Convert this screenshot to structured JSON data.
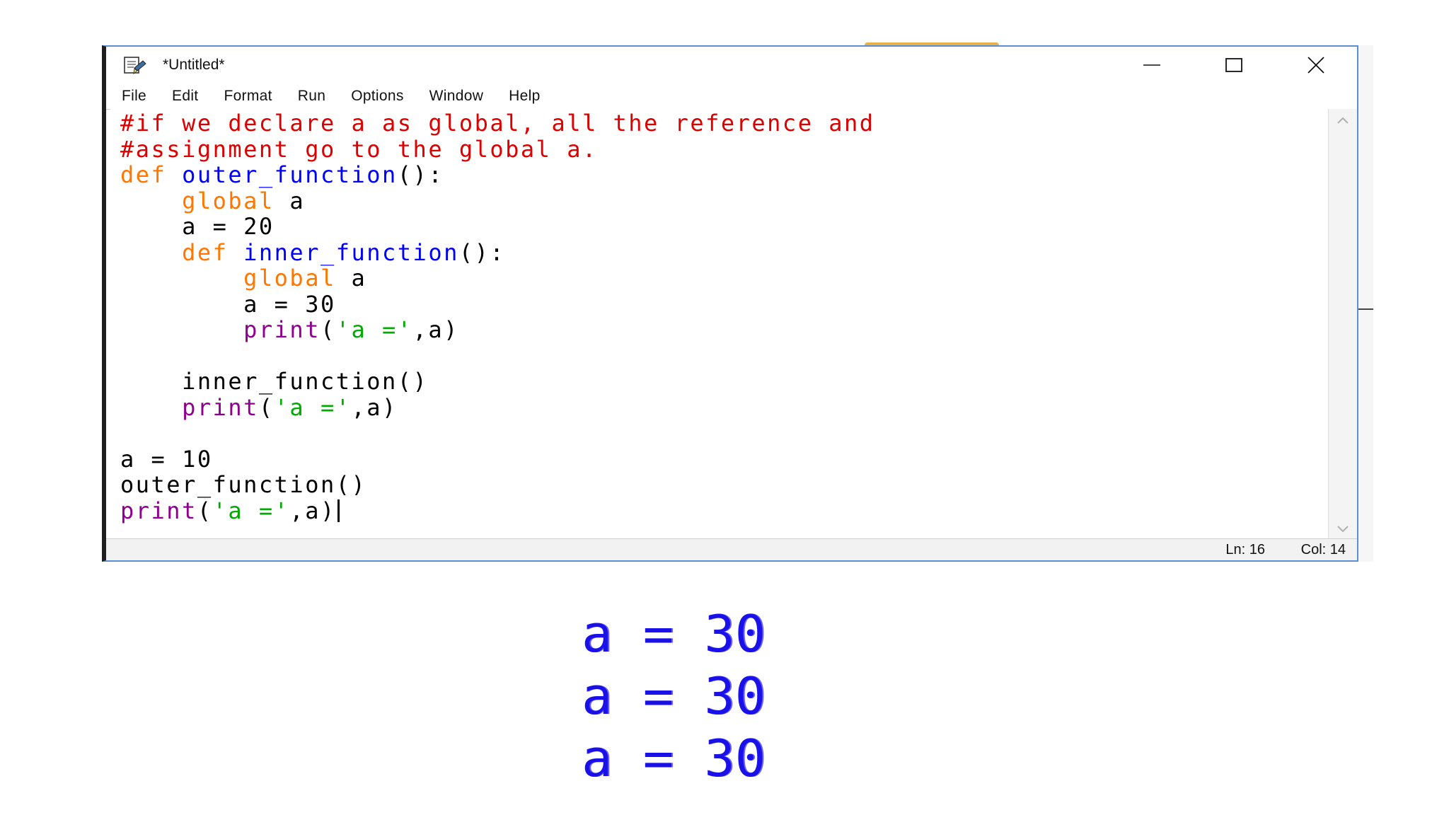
{
  "window": {
    "title": "*Untitled*",
    "icon": "idle-app-icon"
  },
  "window_controls": {
    "minimize_icon": "minimize-icon",
    "maximize_icon": "maximize-icon",
    "close_icon": "close-icon"
  },
  "menubar": {
    "items": [
      "File",
      "Edit",
      "Format",
      "Run",
      "Options",
      "Window",
      "Help"
    ]
  },
  "editor": {
    "lines": [
      [
        {
          "t": "#if we declare a as global, all the reference and",
          "c": "comment"
        }
      ],
      [
        {
          "t": "#assignment go to the global a.",
          "c": "comment"
        }
      ],
      [
        {
          "t": "def",
          "c": "keyword"
        },
        {
          "t": " ",
          "c": "plain"
        },
        {
          "t": "outer_function",
          "c": "defname"
        },
        {
          "t": "():",
          "c": "plain"
        }
      ],
      [
        {
          "t": "    ",
          "c": "plain"
        },
        {
          "t": "global",
          "c": "keyword"
        },
        {
          "t": " a",
          "c": "plain"
        }
      ],
      [
        {
          "t": "    a = 20",
          "c": "plain"
        }
      ],
      [
        {
          "t": "    ",
          "c": "plain"
        },
        {
          "t": "def",
          "c": "keyword"
        },
        {
          "t": " ",
          "c": "plain"
        },
        {
          "t": "inner_function",
          "c": "defname"
        },
        {
          "t": "():",
          "c": "plain"
        }
      ],
      [
        {
          "t": "        ",
          "c": "plain"
        },
        {
          "t": "global",
          "c": "keyword"
        },
        {
          "t": " a",
          "c": "plain"
        }
      ],
      [
        {
          "t": "        a = 30",
          "c": "plain"
        }
      ],
      [
        {
          "t": "        ",
          "c": "plain"
        },
        {
          "t": "print",
          "c": "builtin"
        },
        {
          "t": "(",
          "c": "plain"
        },
        {
          "t": "'a ='",
          "c": "string"
        },
        {
          "t": ",a)",
          "c": "plain"
        }
      ],
      [
        {
          "t": "",
          "c": "plain"
        }
      ],
      [
        {
          "t": "    inner_function()",
          "c": "plain"
        }
      ],
      [
        {
          "t": "    ",
          "c": "plain"
        },
        {
          "t": "print",
          "c": "builtin"
        },
        {
          "t": "(",
          "c": "plain"
        },
        {
          "t": "'a ='",
          "c": "string"
        },
        {
          "t": ",a)",
          "c": "plain"
        }
      ],
      [
        {
          "t": "",
          "c": "plain"
        }
      ],
      [
        {
          "t": "a = 10",
          "c": "plain"
        }
      ],
      [
        {
          "t": "outer_function()",
          "c": "plain"
        }
      ],
      [
        {
          "t": "print",
          "c": "builtin"
        },
        {
          "t": "(",
          "c": "plain"
        },
        {
          "t": "'a ='",
          "c": "string"
        },
        {
          "t": ",a)",
          "c": "plain"
        }
      ]
    ],
    "caret_line": 15
  },
  "scrollbar": {
    "up_icon": "chevron-up-icon",
    "down_icon": "chevron-down-icon"
  },
  "statusbar": {
    "line": "Ln: 16",
    "column": "Col: 14"
  },
  "output": {
    "lines": [
      "a = 30",
      "a = 30",
      "a = 30"
    ]
  },
  "colors": {
    "comment": "#dd0000",
    "keyword": "#ff7700",
    "defname": "#0000ff",
    "builtin": "#900090",
    "string": "#00aa00",
    "output": "#1a10e8",
    "window_border": "#5a8fd6"
  }
}
